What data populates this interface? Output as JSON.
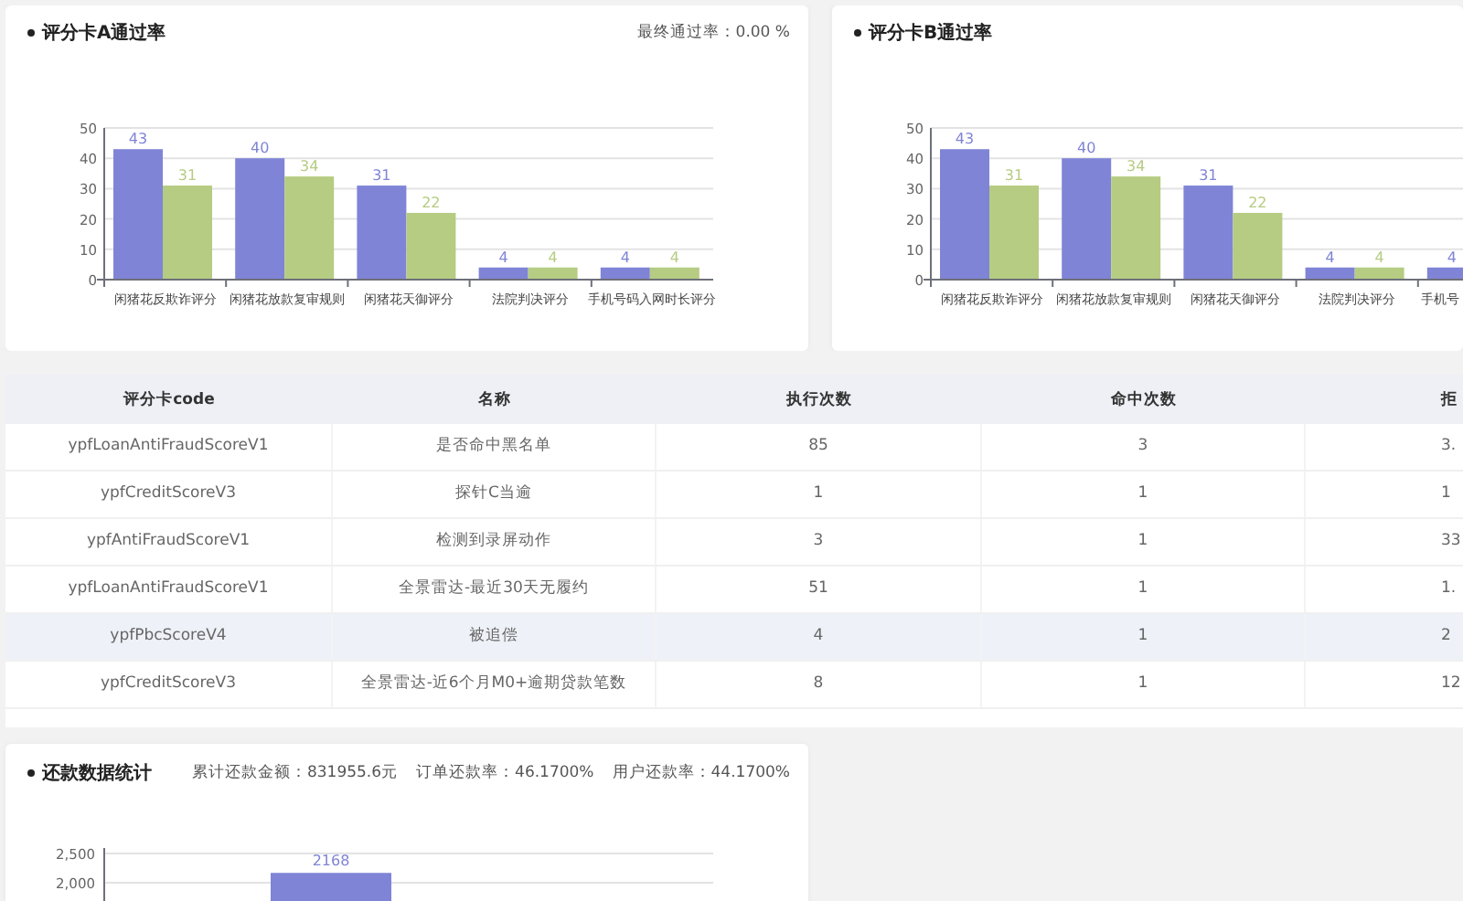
{
  "score_cards": [
    {
      "title": "评分卡A通过率",
      "summary": "最终通过率：0.00 %",
      "chart_data": {
        "type": "bar",
        "categories": [
          "闲猪花反欺诈评分",
          "闲猪花放款复审规则",
          "闲猪花天御评分",
          "法院判决评分",
          "手机号码入网时长评分"
        ],
        "series": [
          {
            "color": "#7f84d6",
            "values": [
              43,
              40,
              31,
              4,
              4
            ]
          },
          {
            "color": "#b5cc82",
            "values": [
              31,
              34,
              22,
              4,
              4
            ]
          }
        ],
        "yticks": [
          0,
          10,
          20,
          30,
          40,
          50
        ],
        "ylim": [
          0,
          50
        ],
        "grid": true,
        "data_labels": true
      }
    },
    {
      "title": "评分卡B通过率",
      "chart_data": {
        "type": "bar",
        "categories": [
          "闲猪花反欺诈评分",
          "闲猪花放款复审规则",
          "闲猪花天御评分",
          "法院判决评分",
          "手机号"
        ],
        "series": [
          {
            "color": "#7f84d6",
            "values": [
              43,
              40,
              31,
              4,
              4
            ]
          },
          {
            "color": "#b5cc82",
            "values": [
              31,
              34,
              22,
              4,
              null
            ]
          }
        ],
        "yticks": [
          0,
          10,
          20,
          30,
          40,
          50
        ],
        "ylim": [
          0,
          50
        ],
        "grid": true,
        "data_labels": true
      }
    }
  ],
  "table": {
    "columns": [
      "评分卡code",
      "名称",
      "执行次数",
      "命中次数",
      "拒"
    ],
    "rows": [
      {
        "selected": false,
        "cells": [
          "ypfLoanAntiFraudScoreV1",
          "是否命中黑名单",
          "85",
          "3",
          "3."
        ]
      },
      {
        "selected": false,
        "cells": [
          "ypfCreditScoreV3",
          "探针C当逾",
          "1",
          "1",
          "1"
        ]
      },
      {
        "selected": false,
        "cells": [
          "ypfAntiFraudScoreV1",
          "检测到录屏动作",
          "3",
          "1",
          "33"
        ]
      },
      {
        "selected": false,
        "cells": [
          "ypfLoanAntiFraudScoreV1",
          "全景雷达-最近30天无履约",
          "51",
          "1",
          "1."
        ]
      },
      {
        "selected": true,
        "cells": [
          "ypfPbcScoreV4",
          "被追偿",
          "4",
          "1",
          "2"
        ]
      },
      {
        "selected": false,
        "cells": [
          "ypfCreditScoreV3",
          "全景雷达-近6个月M0+逾期贷款笔数",
          "8",
          "1",
          "12"
        ]
      }
    ]
  },
  "repayment": {
    "title": "还款数据统计",
    "stats": [
      "累计还款金额：831955.6元",
      "订单还款率：46.1700%",
      "用户还款率：44.1700%"
    ],
    "chart_data": {
      "type": "bar",
      "values": [
        2168
      ],
      "yticks": [
        {
          "value": 2000,
          "label": "2,000"
        },
        {
          "value": 2500,
          "label": "2,500"
        }
      ],
      "ylim": [
        0,
        2500
      ],
      "grid": true,
      "data_labels": true,
      "color": "#7f84d6"
    }
  }
}
